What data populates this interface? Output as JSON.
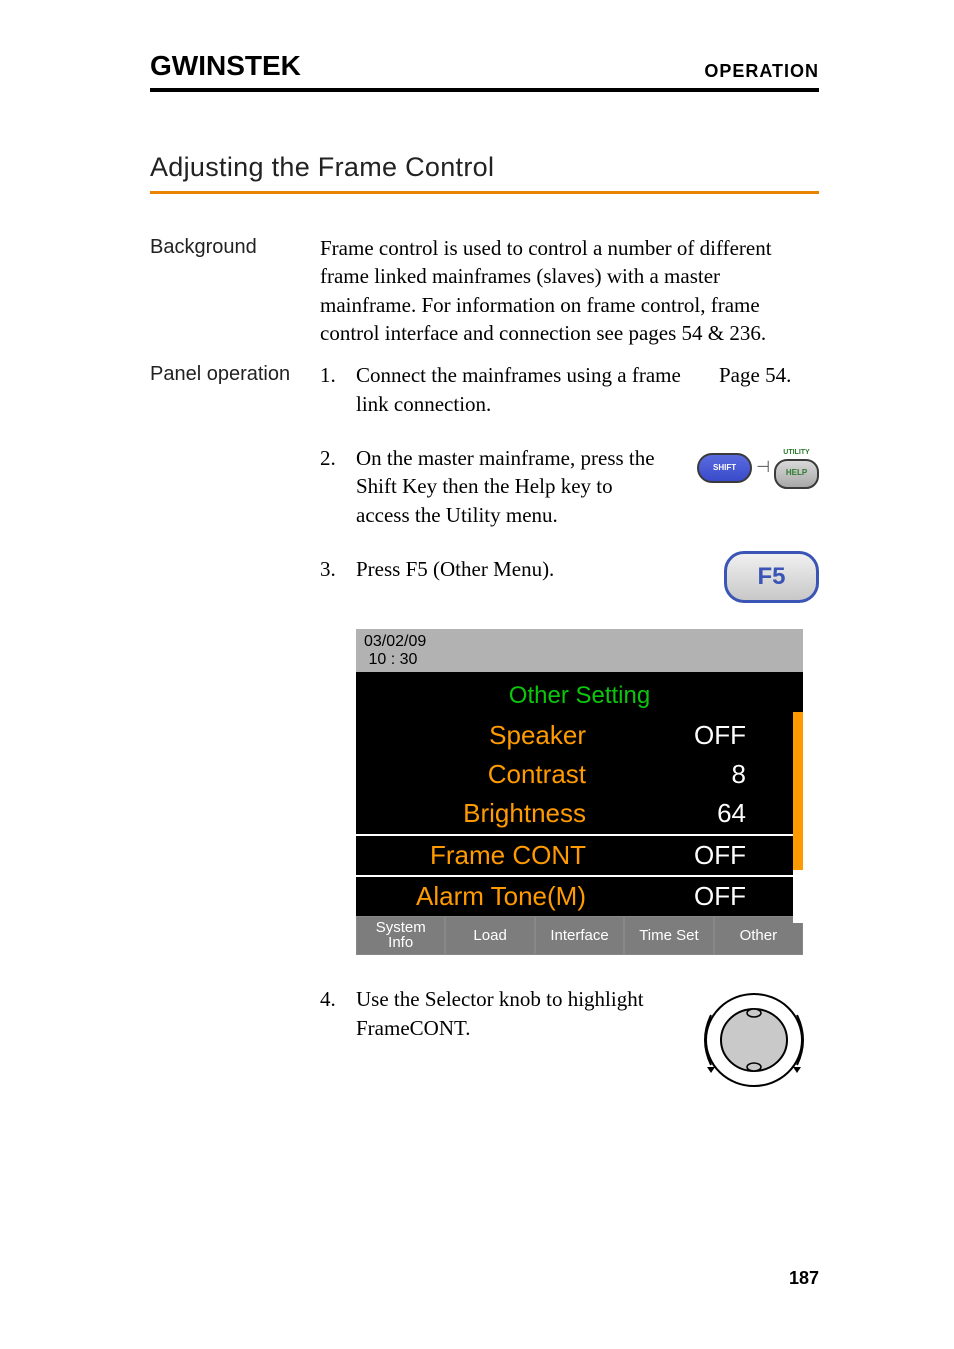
{
  "header": {
    "brand": "GWINSTEK",
    "section": "OPERATION"
  },
  "title": "Adjusting the Frame Control",
  "background": {
    "label": "Background",
    "text": "Frame control is used to control a number of different frame linked mainframes (slaves) with a master mainframe. For information on frame control, frame control interface and connection see pages 54 & 236."
  },
  "panel": {
    "label": "Panel operation",
    "steps": [
      {
        "n": "1.",
        "text": "Connect the mainframes using a frame link connection.",
        "ref": "Page 54."
      },
      {
        "n": "2.",
        "text": "On the master mainframe, press the Shift Key then the Help key to access the Utility menu."
      },
      {
        "n": "3.",
        "text": "Press F5 (Other Menu)."
      },
      {
        "n": "4.",
        "text": "Use the Selector knob to highlight FrameCONT."
      }
    ]
  },
  "keys": {
    "shift": "SHIFT",
    "help": "HELP",
    "utility": "UTILITY",
    "f5": "F5"
  },
  "lcd": {
    "date": "03/02/09",
    "time": "10 : 30",
    "title": "Other Setting",
    "rows": [
      {
        "k": "Speaker",
        "v": "OFF"
      },
      {
        "k": "Contrast",
        "v": "8"
      },
      {
        "k": "Brightness",
        "v": "64"
      },
      {
        "k": "Frame CONT",
        "v": "OFF",
        "hl": true
      },
      {
        "k": "Alarm Tone(M)",
        "v": "OFF"
      }
    ],
    "menu": [
      "System\nInfo",
      "Load",
      "Interface",
      "Time Set",
      "Other"
    ]
  },
  "page_number": "187"
}
